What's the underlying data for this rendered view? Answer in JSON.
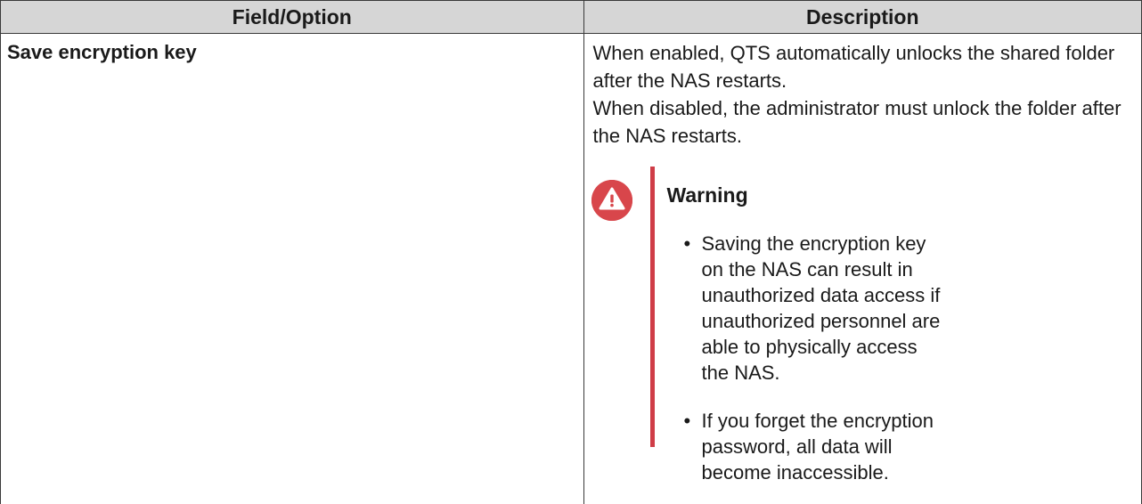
{
  "table": {
    "headers": {
      "field": "Field/Option",
      "description": "Description"
    },
    "rows": [
      {
        "field": "Save encryption key",
        "description": {
          "enabled": "When enabled, QTS automatically unlocks the shared folder after the NAS restarts.",
          "disabled": "When disabled, the administrator must unlock the folder after the NAS restarts."
        },
        "warning": {
          "icon": "warning-icon",
          "title": "Warning",
          "color": "#cf3d47",
          "items": [
            "Saving the encryption key on the NAS can result in unauthorized data access if unauthorized personnel are able to physically access the NAS.",
            "If you forget the encryption password, all data will become inaccessible."
          ]
        }
      }
    ]
  }
}
